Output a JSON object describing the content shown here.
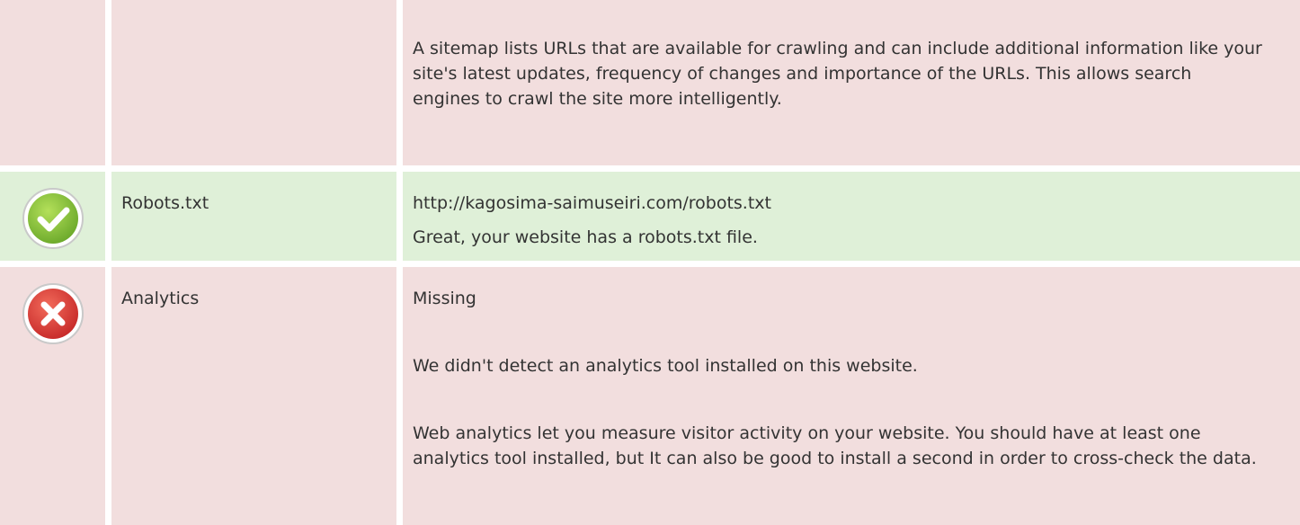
{
  "colors": {
    "fail_bg": "#f2dede",
    "pass_bg": "#dff0d8",
    "text": "#333333",
    "pass_icon": "#8cc63f",
    "fail_icon": "#e0413a"
  },
  "rows": [
    {
      "status": "fail",
      "label": "",
      "paragraphs": [
        "A sitemap lists URLs that are available for crawling and can include additional information like your site's latest updates, frequency of changes and importance of the URLs. This allows search engines to crawl the site more intelligently."
      ]
    },
    {
      "status": "pass",
      "icon": "check-icon",
      "label": "Robots.txt",
      "paragraphs": [
        "http://kagosima-saimuseiri.com/robots.txt",
        "Great, your website has a robots.txt file."
      ]
    },
    {
      "status": "fail",
      "icon": "cross-icon",
      "label": "Analytics",
      "paragraphs": [
        "Missing",
        "We didn't detect an analytics tool installed on this website.",
        "Web analytics let you measure visitor activity on your website. You should have at least one analytics tool installed, but It can also be good to install a second in order to cross-check the data."
      ]
    }
  ]
}
